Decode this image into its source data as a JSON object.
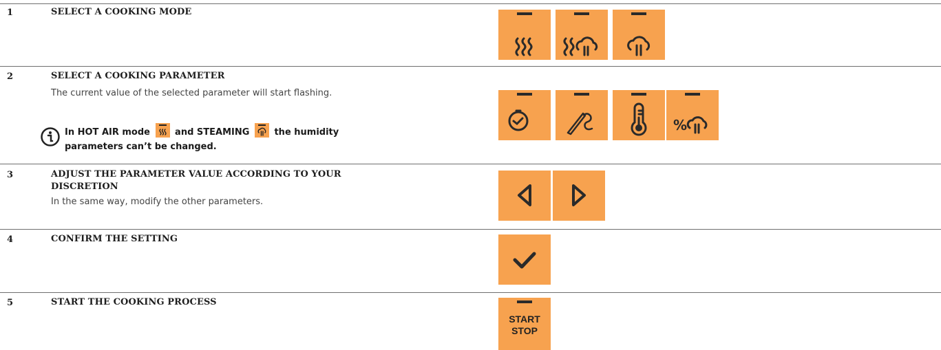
{
  "steps": [
    {
      "number": "1",
      "title": "SELECT A COOKING MODE"
    },
    {
      "number": "2",
      "title": "SELECT A COOKING PARAMETER",
      "description": "The current value of the selected parameter will start flashing.",
      "note": {
        "part1": "In HOT AIR mode",
        "part2": "and STEAMING",
        "part3": "the humidity",
        "line2": "parameters can’t be changed."
      }
    },
    {
      "number": "3",
      "title_line1": "ADJUST THE PARAMETER VALUE ACCORDING TO YOUR",
      "title_line2": "DISCRETION",
      "description": "In the same way, modify the other parameters."
    },
    {
      "number": "4",
      "title": "CONFIRM THE SETTING"
    },
    {
      "number": "5",
      "title": "START THE COOKING PROCESS"
    }
  ],
  "buttons": {
    "modes": [
      "hot-air-icon",
      "combi-icon",
      "steam-icon"
    ],
    "parameters": [
      "timer-icon",
      "core-probe-icon",
      "temperature-icon",
      "humidity-icon"
    ],
    "arrows": [
      "arrow-left-icon",
      "arrow-right-icon"
    ],
    "confirm": "checkmark-icon",
    "start_stop": {
      "line1": "START",
      "line2": "STOP"
    }
  },
  "colors": {
    "button": "#f7a24f",
    "icon": "#2a2a2a",
    "rule": "#6e6e6e"
  }
}
